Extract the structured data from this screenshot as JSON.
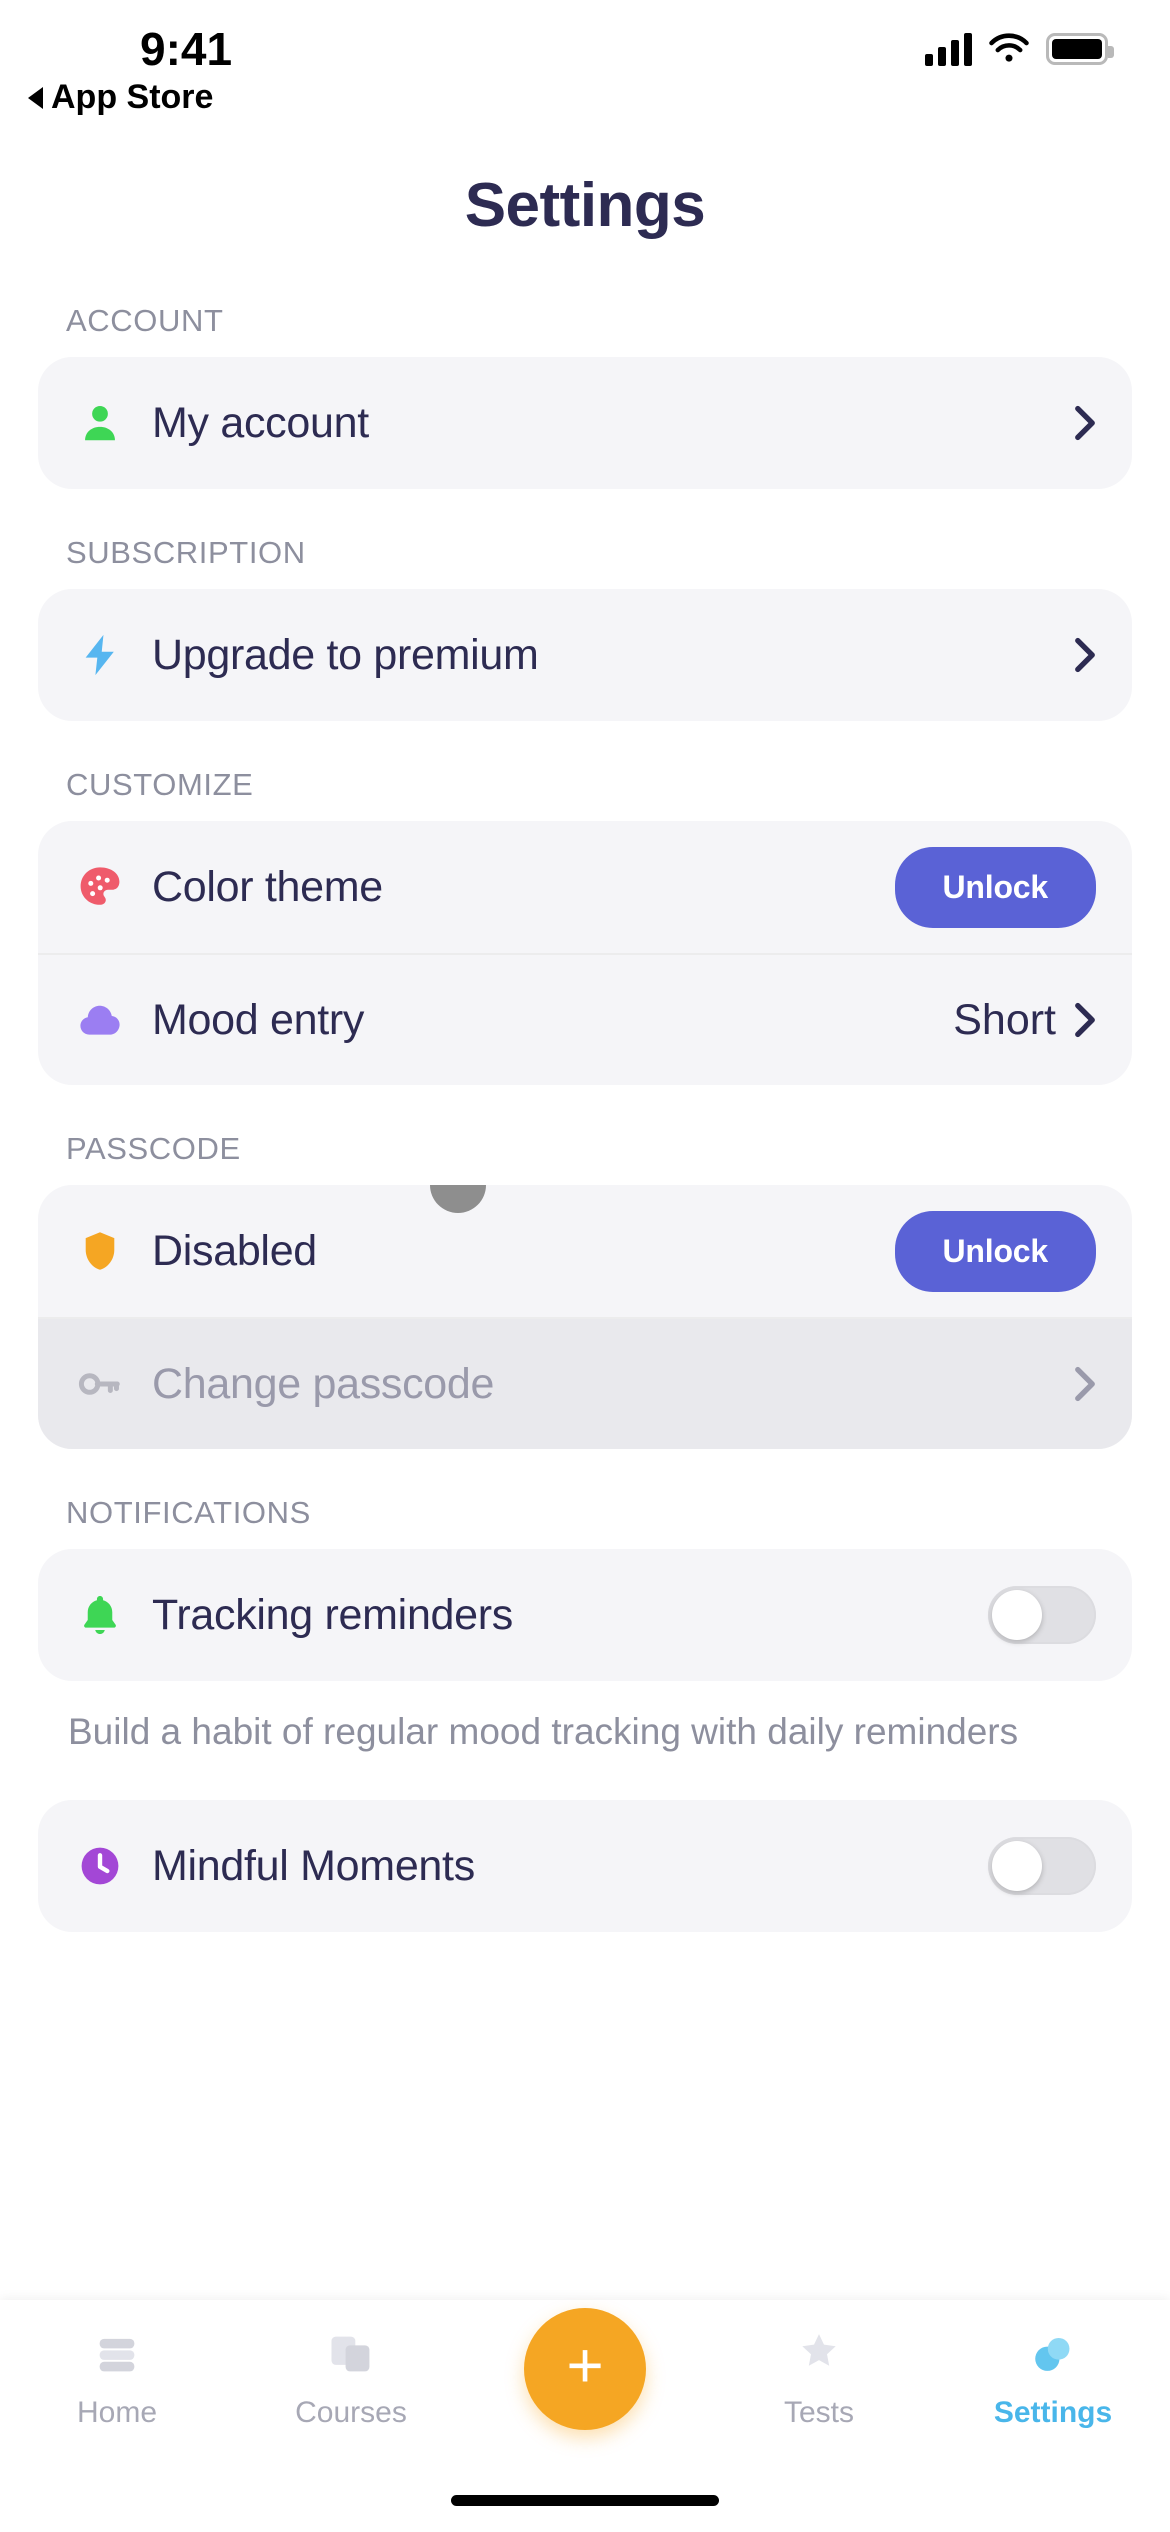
{
  "status_bar": {
    "time": "9:41",
    "back_label": "App Store"
  },
  "header": {
    "title": "Settings"
  },
  "sections": [
    {
      "label": "ACCOUNT",
      "rows": [
        {
          "icon": "person-icon",
          "label": "My account",
          "accessory": "chevron"
        }
      ]
    },
    {
      "label": "SUBSCRIPTION",
      "rows": [
        {
          "icon": "lightning-bolt-icon",
          "label": "Upgrade to premium",
          "accessory": "chevron"
        }
      ]
    },
    {
      "label": "CUSTOMIZE",
      "rows": [
        {
          "icon": "palette-icon",
          "label": "Color theme",
          "accessory": "button",
          "button_label": "Unlock"
        },
        {
          "icon": "cloud-icon",
          "label": "Mood entry",
          "accessory": "value-chevron",
          "value": "Short"
        }
      ]
    },
    {
      "label": "PASSCODE",
      "rows": [
        {
          "icon": "shield-icon",
          "label": "Disabled",
          "accessory": "button",
          "button_label": "Unlock"
        },
        {
          "icon": "key-icon",
          "label": "Change passcode",
          "accessory": "chevron",
          "disabled": true
        }
      ]
    },
    {
      "label": "NOTIFICATIONS",
      "rows": [
        {
          "icon": "bell-icon",
          "label": "Tracking reminders",
          "accessory": "toggle",
          "toggle_on": false
        },
        {
          "icon": "clock-icon",
          "label": "Mindful Moments",
          "accessory": "toggle",
          "toggle_on": false
        }
      ],
      "hint": "Build a habit of regular mood tracking with daily reminders"
    }
  ],
  "tabbar": {
    "items": [
      {
        "icon": "home-icon",
        "label": "Home",
        "active": false
      },
      {
        "icon": "courses-icon",
        "label": "Courses",
        "active": false
      },
      {
        "icon": "plus-icon",
        "label": "",
        "active": false,
        "fab": true
      },
      {
        "icon": "tests-icon",
        "label": "Tests",
        "active": false
      },
      {
        "icon": "settings-icon",
        "label": "Settings",
        "active": true
      }
    ]
  },
  "colors": {
    "title": "#2d2b52",
    "section_label": "#8d8f9e",
    "card_bg": "#f5f5f8",
    "accent_button": "#5a62d6",
    "fab": "#f5a623",
    "active_tab": "#49b6ea",
    "icon_person": "#3ed655",
    "icon_bolt": "#57b6f0",
    "icon_palette": "#ef5b6b",
    "icon_cloud": "#9b7ef2",
    "icon_shield": "#f5a623",
    "icon_key": "#b7b7c0",
    "icon_bell": "#3ed655",
    "icon_clock": "#a347d6"
  }
}
